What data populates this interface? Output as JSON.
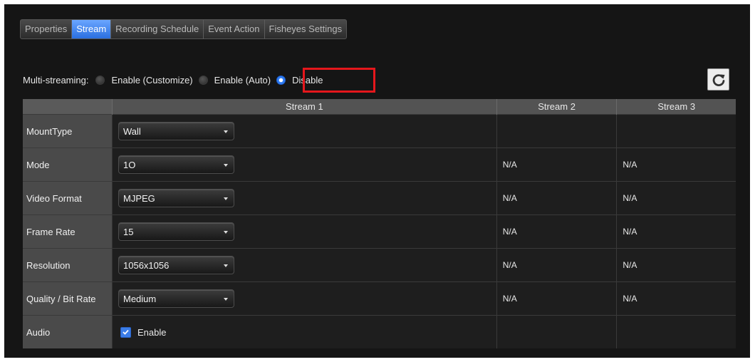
{
  "tabs": [
    {
      "label": "Properties",
      "active": false
    },
    {
      "label": "Stream",
      "active": true
    },
    {
      "label": "Recording Schedule",
      "active": false
    },
    {
      "label": "Event Action",
      "active": false
    },
    {
      "label": "Fisheyes Settings",
      "active": false
    }
  ],
  "multistreaming": {
    "label": "Multi-streaming:",
    "options": [
      {
        "label": "Enable (Customize)",
        "checked": false
      },
      {
        "label": "Enable (Auto)",
        "checked": false
      },
      {
        "label": "Disable",
        "checked": true
      }
    ]
  },
  "refresh_icon": "refresh-icon",
  "table": {
    "headers": [
      "",
      "Stream 1",
      "Stream 2",
      "Stream 3"
    ],
    "rows": {
      "mounttype": {
        "label": "MountType",
        "stream1": "Wall"
      },
      "mode": {
        "label": "Mode",
        "stream1": "1O",
        "stream2": "N/A",
        "stream3": "N/A"
      },
      "video_format": {
        "label": "Video Format",
        "stream1": "MJPEG",
        "stream2": "N/A",
        "stream3": "N/A"
      },
      "frame_rate": {
        "label": "Frame Rate",
        "stream1": "15",
        "stream2": "N/A",
        "stream3": "N/A"
      },
      "resolution": {
        "label": "Resolution",
        "stream1": "1056x1056",
        "stream2": "N/A",
        "stream3": "N/A"
      },
      "quality": {
        "label": "Quality / Bit Rate",
        "stream1": "Medium",
        "stream2": "N/A",
        "stream3": "N/A"
      },
      "audio": {
        "label": "Audio",
        "checkbox_label": "Enable",
        "checked": true
      }
    }
  },
  "colors": {
    "accent": "#2e7bf2",
    "highlight": "#e5171c",
    "panel": "#151515"
  }
}
